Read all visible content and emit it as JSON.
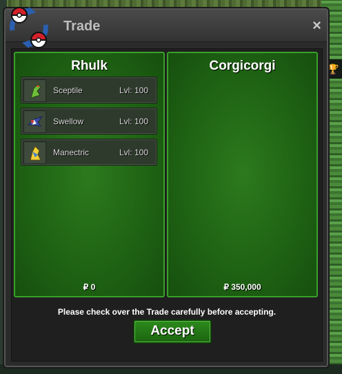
{
  "window": {
    "title": "Trade",
    "close_label": "×"
  },
  "side_tab": {
    "icon": "trophy-icon",
    "glyph": "🏆"
  },
  "left_panel": {
    "player": "Rhulk",
    "money": "₽ 0",
    "pokemon": [
      {
        "name": "Sceptile",
        "level": "Lvl: 100",
        "icon": "sceptile-sprite-icon"
      },
      {
        "name": "Swellow",
        "level": "Lvl: 100",
        "icon": "swellow-sprite-icon"
      },
      {
        "name": "Manectric",
        "level": "Lvl: 100",
        "icon": "manectric-sprite-icon"
      }
    ]
  },
  "right_panel": {
    "player": "Corgicorgi",
    "money": "₽ 350,000",
    "pokemon": []
  },
  "footer": {
    "notice": "Please check over the Trade carefully before accepting.",
    "accept_label": "Accept"
  },
  "colors": {
    "panel_green": "#1f6314",
    "accent_border": "#3aa12a",
    "window_bg": "#2b2b2b"
  }
}
